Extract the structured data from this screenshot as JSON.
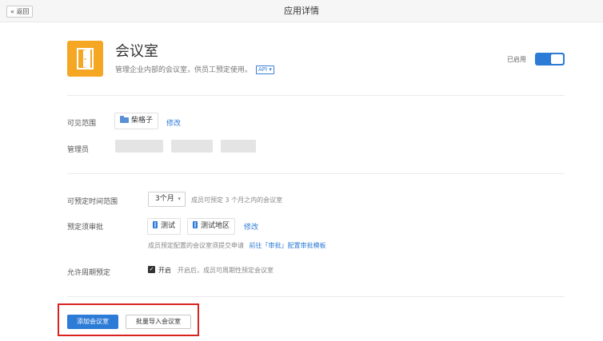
{
  "topbar": {
    "back_label": "« 返回",
    "title": "应用详情"
  },
  "app": {
    "icon": "door-icon",
    "icon_color": "#f5a623",
    "name": "会议室",
    "description": "管理企业内部的会议室，供员工预定使用。",
    "api_tag": "API ▾",
    "enabled_label": "已启用",
    "enabled": true
  },
  "visibility": {
    "label": "可见范围",
    "chip": "柴格子",
    "edit_link": "修改"
  },
  "admins": {
    "label": "管理员"
  },
  "booking_range": {
    "label": "可预定时间范围",
    "selected": "3个月",
    "hint": "成员可预定 3 个月之内的会议室"
  },
  "approval": {
    "label": "预定须审批",
    "chips": [
      "测试",
      "测试地区"
    ],
    "edit_link": "修改",
    "hint_prefix": "成员预定配置的会议室须提交申请",
    "hint_link": "前往「审批」配置审批模板"
  },
  "recurring": {
    "label": "允许周期预定",
    "checkbox_label": "开启",
    "checked": true,
    "hint": "开启后，成员可周期性预定会议室"
  },
  "actions": {
    "add_label": "添加会议室",
    "import_label": "批量导入会议室"
  },
  "colors": {
    "primary": "#2c7bd6",
    "highlight": "#d9231f"
  }
}
